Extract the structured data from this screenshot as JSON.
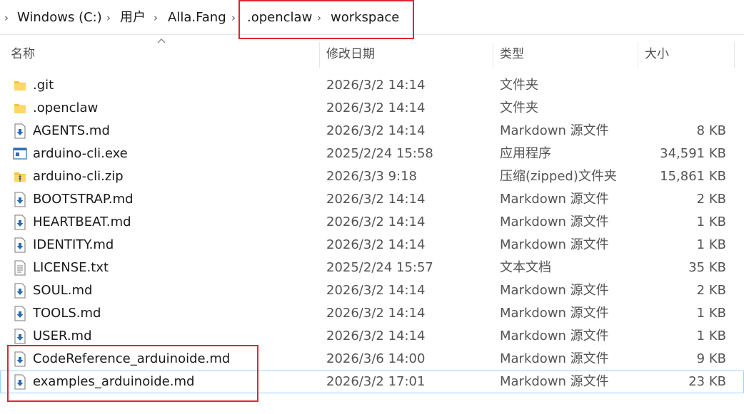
{
  "breadcrumb": {
    "items": [
      {
        "label": "Windows (C:)"
      },
      {
        "label": "用户"
      },
      {
        "label": "Alla.Fang"
      },
      {
        "label": ".openclaw"
      },
      {
        "label": "workspace"
      }
    ]
  },
  "columns": {
    "name": "名称",
    "modified": "修改日期",
    "type": "类型",
    "size": "大小"
  },
  "files": [
    {
      "name": ".git",
      "modified": "2026/3/2 14:14",
      "type": "文件夹",
      "size": "",
      "icon": "folder-icon"
    },
    {
      "name": ".openclaw",
      "modified": "2026/3/2 14:14",
      "type": "文件夹",
      "size": "",
      "icon": "folder-icon"
    },
    {
      "name": "AGENTS.md",
      "modified": "2026/3/2 14:14",
      "type": "Markdown 源文件",
      "size": "8 KB",
      "icon": "markdown-file-icon"
    },
    {
      "name": "arduino-cli.exe",
      "modified": "2025/2/24 15:58",
      "type": "应用程序",
      "size": "34,591 KB",
      "icon": "exe-file-icon"
    },
    {
      "name": "arduino-cli.zip",
      "modified": "2026/3/3 9:18",
      "type": "压缩(zipped)文件夹",
      "size": "15,861 KB",
      "icon": "zip-folder-icon"
    },
    {
      "name": "BOOTSTRAP.md",
      "modified": "2026/3/2 14:14",
      "type": "Markdown 源文件",
      "size": "2 KB",
      "icon": "markdown-file-icon"
    },
    {
      "name": "HEARTBEAT.md",
      "modified": "2026/3/2 14:14",
      "type": "Markdown 源文件",
      "size": "1 KB",
      "icon": "markdown-file-icon"
    },
    {
      "name": "IDENTITY.md",
      "modified": "2026/3/2 14:14",
      "type": "Markdown 源文件",
      "size": "1 KB",
      "icon": "markdown-file-icon"
    },
    {
      "name": "LICENSE.txt",
      "modified": "2025/2/24 15:57",
      "type": "文本文档",
      "size": "35 KB",
      "icon": "text-file-icon"
    },
    {
      "name": "SOUL.md",
      "modified": "2026/3/2 14:14",
      "type": "Markdown 源文件",
      "size": "2 KB",
      "icon": "markdown-file-icon"
    },
    {
      "name": "TOOLS.md",
      "modified": "2026/3/2 14:14",
      "type": "Markdown 源文件",
      "size": "1 KB",
      "icon": "markdown-file-icon"
    },
    {
      "name": "USER.md",
      "modified": "2026/3/2 14:14",
      "type": "Markdown 源文件",
      "size": "1 KB",
      "icon": "markdown-file-icon"
    },
    {
      "name": "CodeReference_arduinoide.md",
      "modified": "2026/3/6 14:00",
      "type": "Markdown 源文件",
      "size": "9 KB",
      "icon": "markdown-file-icon"
    },
    {
      "name": "examples_arduinoide.md",
      "modified": "2026/3/2 17:01",
      "type": "Markdown 源文件",
      "size": "23 KB",
      "icon": "markdown-file-icon",
      "selected": true
    }
  ],
  "colors": {
    "highlight_box": "#e0262e",
    "folder": "#f5c33b",
    "markdown_arrow": "#2b6cb0",
    "selection_border": "#99d1ff"
  }
}
